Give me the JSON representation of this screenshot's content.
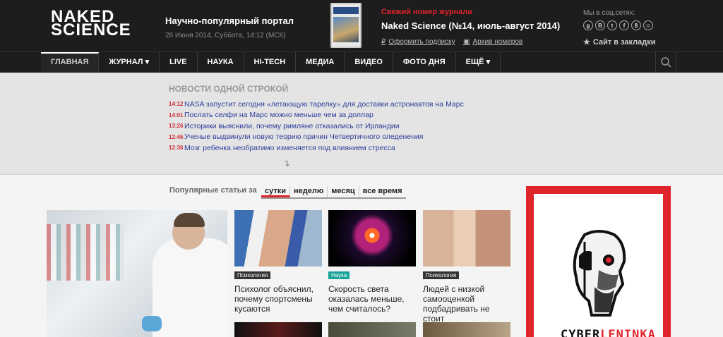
{
  "header": {
    "logo_line1": "NAKED",
    "logo_line2": "SCIENCE",
    "tagline": "Научно-популярный портал",
    "datetime": "28 Июня 2014, Суббота, 14:12 (МСК)",
    "fresh_issue_label": "Свежий номер журнала",
    "issue_title": "Naked Science (№14, июль-август 2014)",
    "subscribe_link": "Оформить подписку",
    "archive_link": "Архив номеров",
    "social_label": "Мы в соц.сетях:",
    "social_icons": [
      "g",
      "В",
      "t",
      "f",
      "8",
      "☺"
    ],
    "bookmark_label": "Сайт в закладки"
  },
  "nav": {
    "items": [
      {
        "label": "ГЛАВНАЯ",
        "active": true
      },
      {
        "label": "ЖУРНАЛ ▾",
        "active": false
      },
      {
        "label": "LIVE",
        "active": false
      },
      {
        "label": "НАУКА",
        "active": false
      },
      {
        "label": "HI-TECH",
        "active": false
      },
      {
        "label": "МЕДИА",
        "active": false
      },
      {
        "label": "ВИДЕО",
        "active": false
      },
      {
        "label": "ФОТО ДНЯ",
        "active": false
      },
      {
        "label": "ЕЩЁ ▾",
        "active": false
      }
    ]
  },
  "news": {
    "title": "НОВОСТИ ОДНОЙ СТРОКОЙ",
    "items": [
      {
        "time": "14:12",
        "text": "NASA запустит сегодня «летающую тарелку» для доставки астронавтов на Марс"
      },
      {
        "time": "14:01",
        "text": "Послать селфи на Марс можно меньше чем за доллар"
      },
      {
        "time": "13:26",
        "text": "Историки выяснили, почему римляне отказались от Ирландии"
      },
      {
        "time": "12:46",
        "text": "Ученые выдвинули новую теорию причин Четвертичного оледенения"
      },
      {
        "time": "12:36",
        "text": "Мозг ребенка необратимо изменяется под влиянием стресса"
      }
    ]
  },
  "popular": {
    "label": "Популярные статьи за",
    "tabs": [
      {
        "label": "сутки",
        "active": true
      },
      {
        "label": "неделю",
        "active": false
      },
      {
        "label": "месяц",
        "active": false
      },
      {
        "label": "все время",
        "active": false
      }
    ]
  },
  "cards": [
    {
      "tag": "Психология",
      "tag_color": "#333333",
      "title": "Психолог объяснил, почему спортсмены кусаются"
    },
    {
      "tag": "Наука",
      "tag_color": "#17a398",
      "title": "Скорость света оказалась меньше, чем считалось?"
    },
    {
      "tag": "Психология",
      "tag_color": "#333333",
      "title": "Людей с низкой самооценкой подбадривать не стоит"
    }
  ],
  "ad": {
    "brand_part1": "CYBER",
    "brand_part2": "LENINKA"
  }
}
